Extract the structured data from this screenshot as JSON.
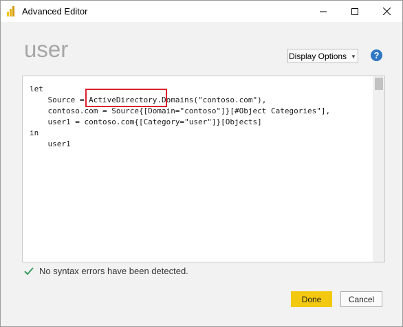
{
  "window": {
    "title": "Advanced Editor",
    "app_icon": "power-bi-icon",
    "controls": [
      "minimize-icon",
      "maximize-icon",
      "close-icon"
    ]
  },
  "header": {
    "query_name": "user",
    "display_options_label": "Display Options",
    "help_icon": "help-icon",
    "help_glyph": "?"
  },
  "editor": {
    "code_lines": [
      "let",
      "    Source = ActiveDirectory.Domains(\"contoso.com\"),",
      "    contoso.com = Source{[Domain=\"contoso\"]}[#Object Categories\"],",
      "    user1 = contoso.com{[Category=\"user\"]}[Objects]",
      "in",
      "    user1"
    ],
    "highlight_color": "#d9232d"
  },
  "status": {
    "icon": "check-icon",
    "text": "No syntax errors have been detected."
  },
  "buttons": {
    "done_label": "Done",
    "cancel_label": "Cancel"
  },
  "colors": {
    "done_button": "#f2c811",
    "help_icon": "#2f78c4",
    "check": "#3c9a5f"
  }
}
